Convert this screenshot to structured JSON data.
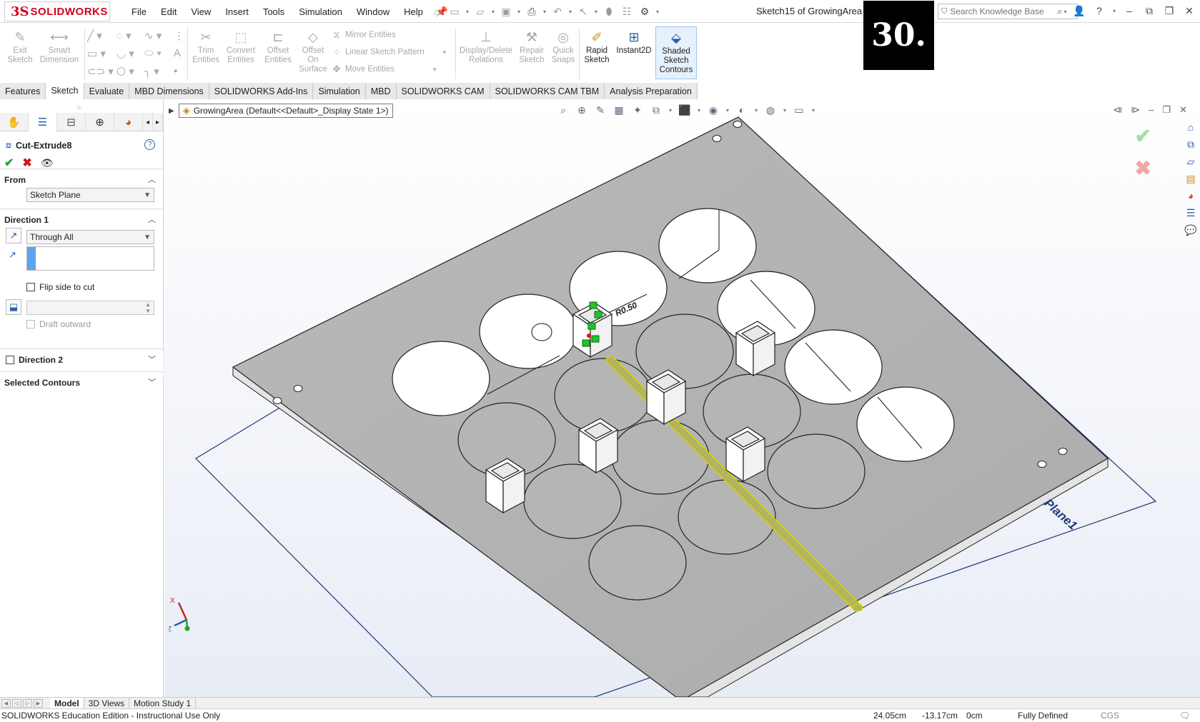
{
  "app": {
    "logo_ds": "3S",
    "logo_text": "SOLIDWORKS",
    "menus": [
      "File",
      "Edit",
      "View",
      "Insert",
      "Tools",
      "Simulation",
      "Window",
      "Help"
    ],
    "document_title": "Sketch15 of GrowingArea *",
    "step_badge": "30.",
    "search_placeholder": "Search Knowledge Base"
  },
  "ribbon": {
    "exit_sketch": "Exit\nSketch",
    "smart_dimension": "Smart\nDimension",
    "trim_entities": "Trim\nEntities",
    "convert_entities": "Convert\nEntities",
    "offset_entities": "Offset\nEntities",
    "offset_on_surface": "Offset\nOn\nSurface",
    "mirror_entities": "Mirror Entities",
    "linear_sketch_pattern": "Linear Sketch Pattern",
    "move_entities": "Move Entities",
    "display_delete_relations": "Display/Delete\nRelations",
    "repair_sketch": "Repair\nSketch",
    "quick_snaps": "Quick\nSnaps",
    "rapid_sketch": "Rapid\nSketch",
    "instant2d": "Instant2D",
    "shaded_sketch_contours": "Shaded\nSketch\nContours"
  },
  "tabs": [
    "Features",
    "Sketch",
    "Evaluate",
    "MBD Dimensions",
    "SOLIDWORKS Add-Ins",
    "Simulation",
    "MBD",
    "SOLIDWORKS CAM",
    "SOLIDWORKS CAM TBM",
    "Analysis Preparation"
  ],
  "active_tab": "Sketch",
  "property_manager": {
    "feature_name": "Cut-Extrude8",
    "from_label": "From",
    "from_value": "Sketch Plane",
    "direction1_label": "Direction 1",
    "direction1_type": "Through All",
    "flip_side_label": "Flip side to cut",
    "draft_outward_label": "Draft outward",
    "direction2_label": "Direction 2",
    "selected_contours_label": "Selected Contours"
  },
  "viewport": {
    "tree_node": "GrowingArea  (Default<<Default>_Display State 1>)",
    "plane_label": "Plane1",
    "dimension_label": "R0.50",
    "triad_x": "X",
    "triad_z": "Z"
  },
  "bottom_tabs": [
    "Model",
    "3D Views",
    "Motion Study 1"
  ],
  "active_bottom_tab": "Model",
  "status": {
    "edition": "SOLIDWORKS Education Edition - Instructional Use Only",
    "x": "24.05cm",
    "y": "-13.17cm",
    "z": "0cm",
    "state": "Fully Defined",
    "units": "CGS"
  },
  "colors": {
    "brand_red": "#d6001c",
    "plate_gray": "#b5b5b5",
    "plane_blue": "#1a3a78",
    "sketch_green": "#22c22b",
    "highlight_yellow": "#d8d800"
  }
}
